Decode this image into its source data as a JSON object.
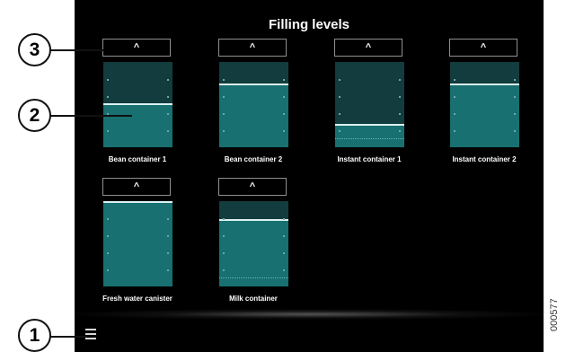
{
  "screen": {
    "title": "Filling levels",
    "up_label": "^",
    "containers": [
      {
        "label": "Bean container 1",
        "fill_percent": 49,
        "min_mark": false
      },
      {
        "label": "Bean container 2",
        "fill_percent": 73,
        "min_mark": false
      },
      {
        "label": "Instant container 1",
        "fill_percent": 25,
        "min_mark": true
      },
      {
        "label": "Instant container 2",
        "fill_percent": 73,
        "min_mark": false
      },
      {
        "label": "Fresh water canister",
        "fill_percent": 100,
        "min_mark": false
      },
      {
        "label": "Milk container",
        "fill_percent": 77,
        "min_mark": true
      }
    ],
    "colors": {
      "background": "#000000",
      "gauge_empty": "#123c3d",
      "gauge_fill": "#187070",
      "level_line": "#dcf1f1"
    },
    "menu_icon": "hamburger-menu-icon"
  },
  "callouts": [
    "1",
    "2",
    "3"
  ],
  "image_code": "000577"
}
